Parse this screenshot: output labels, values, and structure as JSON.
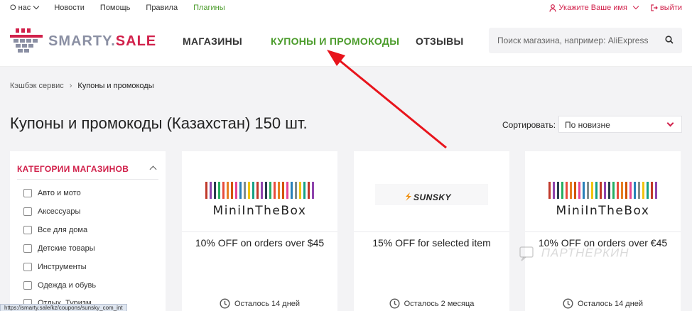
{
  "topbar": {
    "links": [
      "О нас",
      "Новости",
      "Помощь",
      "Правила",
      "Плагины"
    ],
    "user_label": "Укажите Ваше имя",
    "logout_label": "выйти"
  },
  "header": {
    "logo_part1": "SMARTY.",
    "logo_part2": "SALE",
    "nav": [
      "МАГАЗИНЫ",
      "КУПОНЫ И ПРОМОКОДЫ",
      "ОТЗЫВЫ"
    ],
    "search_placeholder": "Поиск магазина, например: AliExpress"
  },
  "breadcrumb": {
    "root": "Кэшбэк сервис",
    "current": "Купоны и промокоды"
  },
  "page_title": "Купоны и промокоды (Казахстан) 150 шт.",
  "sort": {
    "label": "Сортировать:",
    "value": "По новизне"
  },
  "sidebar": {
    "title": "КАТЕГОРИИ МАГАЗИНОВ",
    "categories": [
      "Авто и мото",
      "Аксессуары",
      "Все для дома",
      "Детские товары",
      "Инструменты",
      "Одежда и обувь",
      "Отдых, Туризм"
    ]
  },
  "coupons": [
    {
      "store": "MiniInTheBox",
      "offer": "10% OFF on orders over $45",
      "remaining": "Осталось 14 дней"
    },
    {
      "store": "SUNSKY",
      "offer": "15% OFF for selected item",
      "remaining": "Осталось 2 месяца"
    },
    {
      "store": "MiniInTheBox",
      "offer": "10% OFF on orders over €45",
      "remaining": "Осталось 14 дней"
    }
  ],
  "watermark": "ПАРТНЕРКИН",
  "status_url": "https://smarty.sale/kz/coupons/sunsky_com_int",
  "colors": {
    "brand_red": "#d1214b",
    "active_green": "#4a9b2a",
    "annotation_arrow": "#e8141c"
  },
  "icons": [
    "chevron-down-icon",
    "user-icon",
    "logout-icon",
    "logo-basket-icon",
    "search-icon",
    "chevron-up-icon",
    "clock-icon",
    "arrow-annotation"
  ]
}
